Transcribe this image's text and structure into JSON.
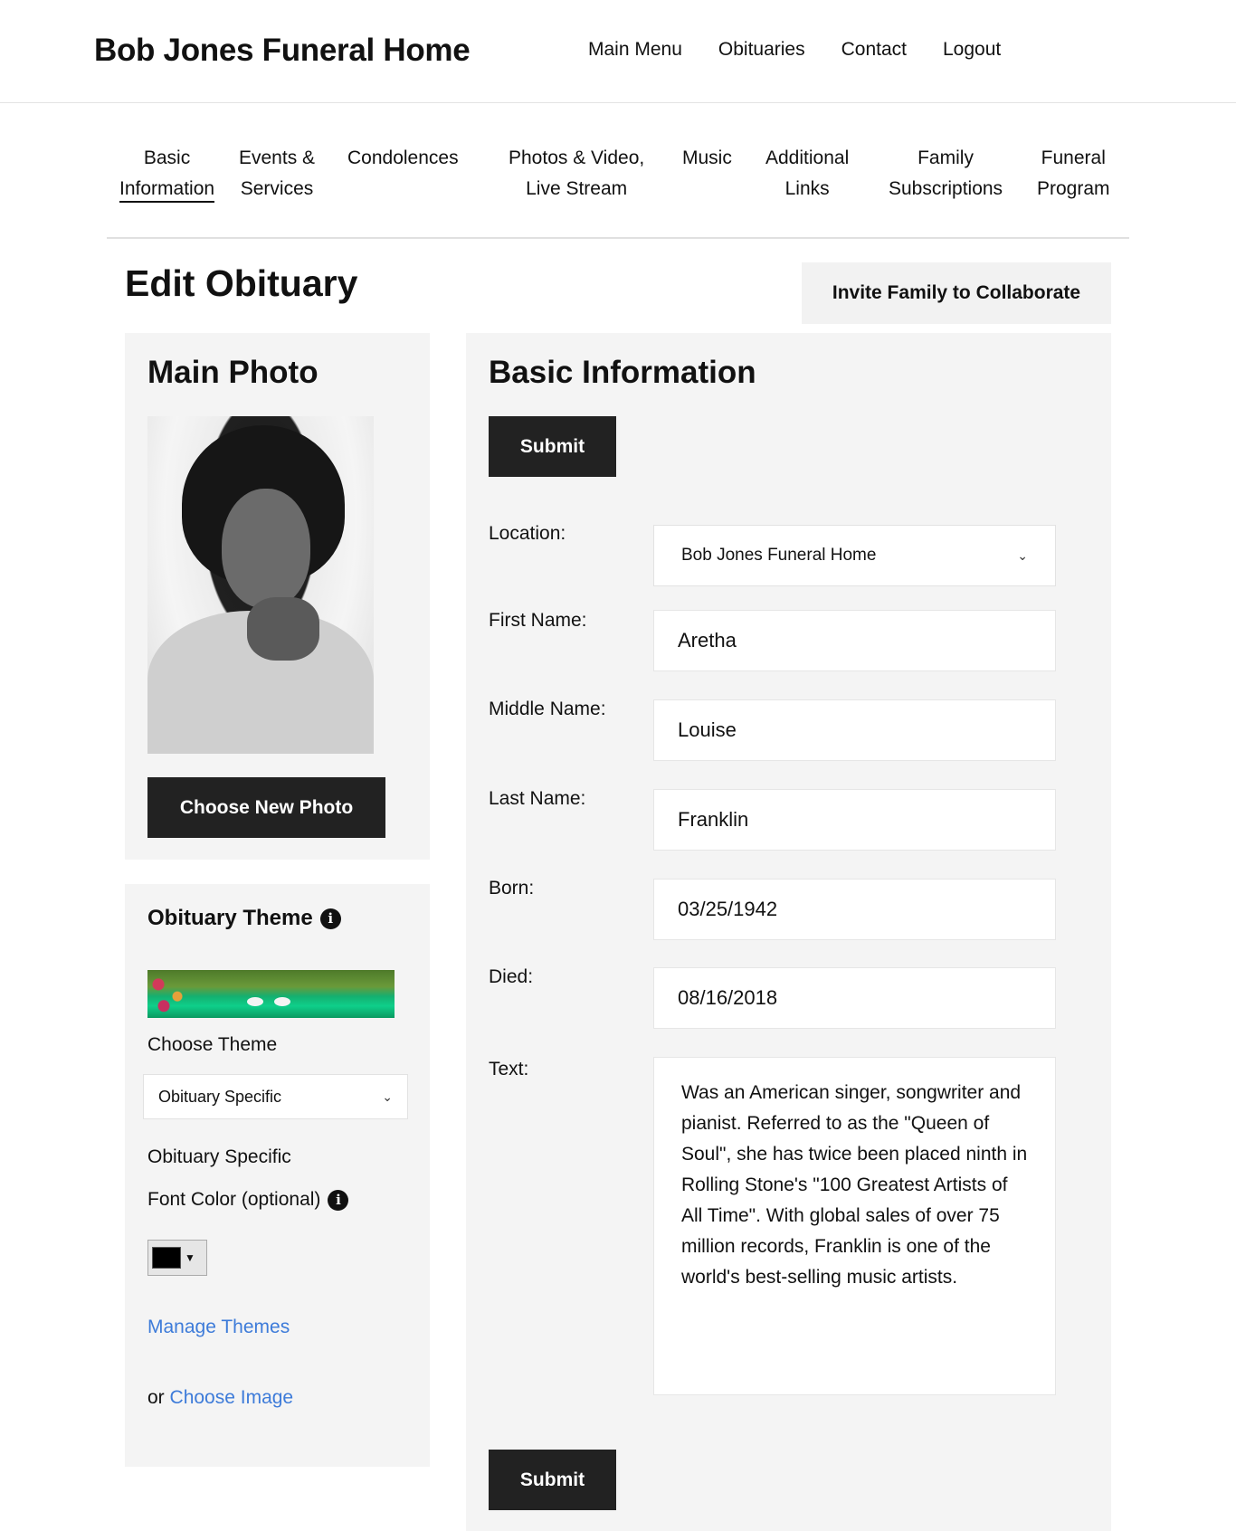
{
  "header": {
    "brand": "Bob Jones Funeral Home",
    "nav": [
      "Main Menu",
      "Obituaries",
      "Contact",
      "Logout"
    ]
  },
  "tabs": [
    {
      "line1": "Basic",
      "line2": "Information",
      "active": true
    },
    {
      "line1": "Events &",
      "line2": "Services",
      "active": false
    },
    {
      "line1": "Condolences",
      "line2": "",
      "active": false
    },
    {
      "line1": "Photos & Video,",
      "line2": "Live Stream",
      "active": false
    },
    {
      "line1": "Music",
      "line2": "",
      "active": false
    },
    {
      "line1": "Additional",
      "line2": "Links",
      "active": false
    },
    {
      "line1": "Family",
      "line2": "Subscriptions",
      "active": false
    },
    {
      "line1": "Funeral",
      "line2": "Program",
      "active": false
    }
  ],
  "page": {
    "title": "Edit Obituary",
    "invite_label": "Invite Family to Collaborate"
  },
  "main_photo": {
    "title": "Main Photo",
    "choose_label": "Choose New Photo"
  },
  "theme": {
    "title": "Obituary Theme",
    "choose_theme_label": "Choose Theme",
    "select_value": "Obituary Specific",
    "specific_label": "Obituary Specific",
    "font_color_label": "Font Color (optional)",
    "font_color_value": "#000000",
    "manage_label": "Manage Themes",
    "or_label": "or",
    "choose_image_label": "Choose Image"
  },
  "basic_info": {
    "title": "Basic Information",
    "submit_label": "Submit",
    "fields": {
      "location": {
        "label": "Location:",
        "value": "Bob Jones Funeral Home"
      },
      "first_name": {
        "label": "First Name:",
        "value": "Aretha"
      },
      "middle_name": {
        "label": "Middle Name:",
        "value": "Louise"
      },
      "last_name": {
        "label": "Last Name:",
        "value": "Franklin"
      },
      "born": {
        "label": "Born:",
        "value": "03/25/1942"
      },
      "died": {
        "label": "Died:",
        "value": "08/16/2018"
      },
      "text": {
        "label": "Text:",
        "value": "Was an American singer, songwriter and pianist. Referred to as the \"Queen of Soul\", she has twice been placed ninth in Rolling Stone's \"100 Greatest Artists of All Time\". With global sales of over 75 million records, Franklin is one of the world's best-selling music artists."
      }
    }
  },
  "colors": {
    "accent_link": "#3d7bd9",
    "dark_button": "#222222",
    "panel_bg": "#f4f4f4"
  }
}
